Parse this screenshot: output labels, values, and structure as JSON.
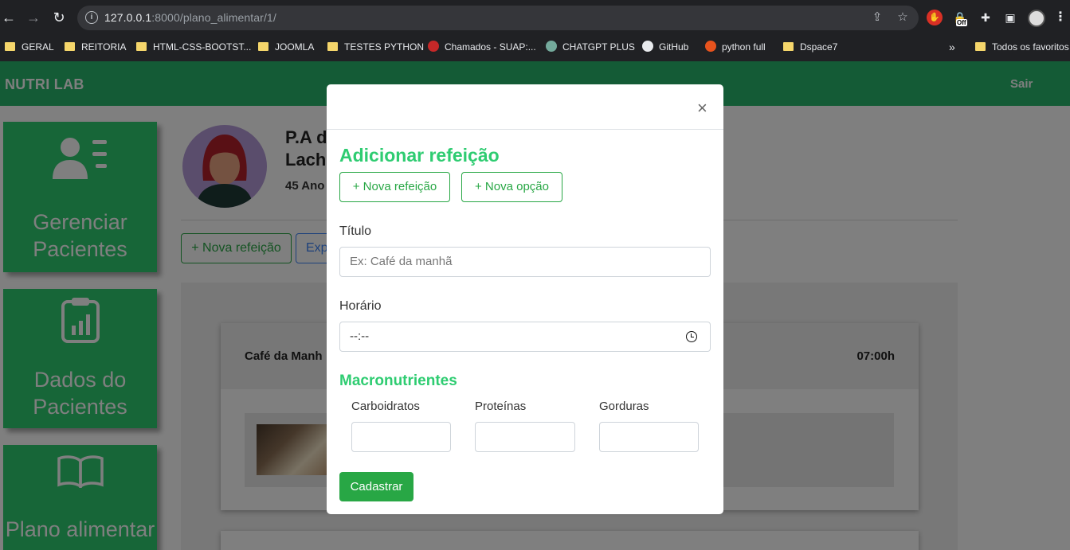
{
  "browser": {
    "url_host": "127.0.0.1",
    "url_rest": ":8000/plano_alimentar/1/",
    "ext_off_badge": "Off",
    "bookmarks": [
      {
        "label": "GERAL",
        "icon": "folder-icon"
      },
      {
        "label": "REITORIA",
        "icon": "folder-icon"
      },
      {
        "label": "HTML-CSS-BOOTST...",
        "icon": "folder-icon"
      },
      {
        "label": "JOOMLA",
        "icon": "folder-icon"
      },
      {
        "label": "TESTES PYTHON",
        "icon": "folder-icon"
      },
      {
        "label": "Chamados - SUAP:...",
        "icon": "suap-icon"
      },
      {
        "label": "CHATGPT PLUS",
        "icon": "chatgpt-icon"
      },
      {
        "label": "GitHub",
        "icon": "github-icon"
      },
      {
        "label": "python full",
        "icon": "python-icon"
      },
      {
        "label": "Dspace7",
        "icon": "folder-icon"
      }
    ],
    "more_bookmarks": "»",
    "all_bookmarks": "Todos os favoritos"
  },
  "app": {
    "brand": "NUTRI LAB",
    "logout": "Sair",
    "sidebar": [
      {
        "label": "Gerenciar Pacientes",
        "icon": "user-list-icon"
      },
      {
        "label": "Dados do Pacientes",
        "icon": "clipboard-chart-icon"
      },
      {
        "label": "Plano alimentar",
        "icon": "book-icon"
      }
    ],
    "patient": {
      "name_line1": "P.A d",
      "name_line2": "Lach",
      "age": "45 Ano"
    },
    "actions": {
      "new_meal": "+ Nova refeição",
      "export": "Exp"
    },
    "meal": {
      "title": "Café da Manh",
      "time": "07:00h"
    }
  },
  "modal": {
    "close": "×",
    "title": "Adicionar refeição",
    "btn_new_meal": "+ Nova refeição",
    "btn_new_option": "+ Nova opção",
    "title_label": "Título",
    "title_placeholder": "Ex: Café da manhã",
    "time_label": "Horário",
    "time_value": "--:--",
    "macro_title": "Macronutrientes",
    "carbs_label": "Carboidratos",
    "protein_label": "Proteínas",
    "fat_label": "Gorduras",
    "submit": "Cadastrar"
  },
  "colors": {
    "brand_green": "#28b66d",
    "accent_green": "#2ecc71",
    "button_green": "#28a745",
    "chrome_dark": "#202124"
  }
}
